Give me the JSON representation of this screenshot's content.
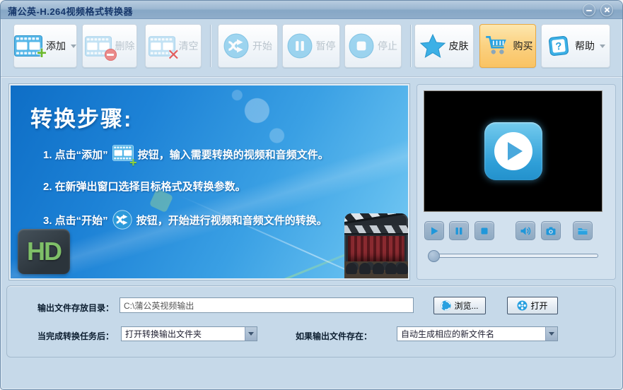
{
  "window": {
    "title": "蒲公英-H.264视频格式转换器"
  },
  "toolbar": {
    "add": "添加",
    "remove": "删除",
    "clear": "清空",
    "start": "开始",
    "pause": "暂停",
    "stop": "停止",
    "skin": "皮肤",
    "buy": "购买",
    "help": "帮助"
  },
  "steps_panel": {
    "heading": "转换步骤:",
    "step1_prefix": "1. 点击“添加”",
    "step1_suffix": "按钮，输入需要转换的视频和音频文件。",
    "step2": "2. 在新弹出窗口选择目标格式及转换参数。",
    "step3_prefix": "3. 点击“开始”",
    "step3_suffix": "按钮，开始进行视频和音频文件的转换。",
    "hd_badge": "HD"
  },
  "output_panel": {
    "dir_label": "输出文件存放目录：",
    "dir_value": "C:\\蒲公英视频输出",
    "browse_label": "浏览...",
    "open_label": "打开",
    "after_label": "当完成转换任务后：",
    "after_value": "打开转换输出文件夹",
    "exists_label": "如果输出文件存在：",
    "exists_value": "自动生成相应的新文件名"
  },
  "colors": {
    "accent_blue": "#2fa3e0",
    "buy_orange": "#f9c363",
    "panel_blue_top": "#0e6ec6",
    "panel_blue_bottom": "#7bcbf3",
    "disabled_text": "#b9c4cd",
    "hd_green": "#7fc068",
    "title_text": "#16376b"
  }
}
